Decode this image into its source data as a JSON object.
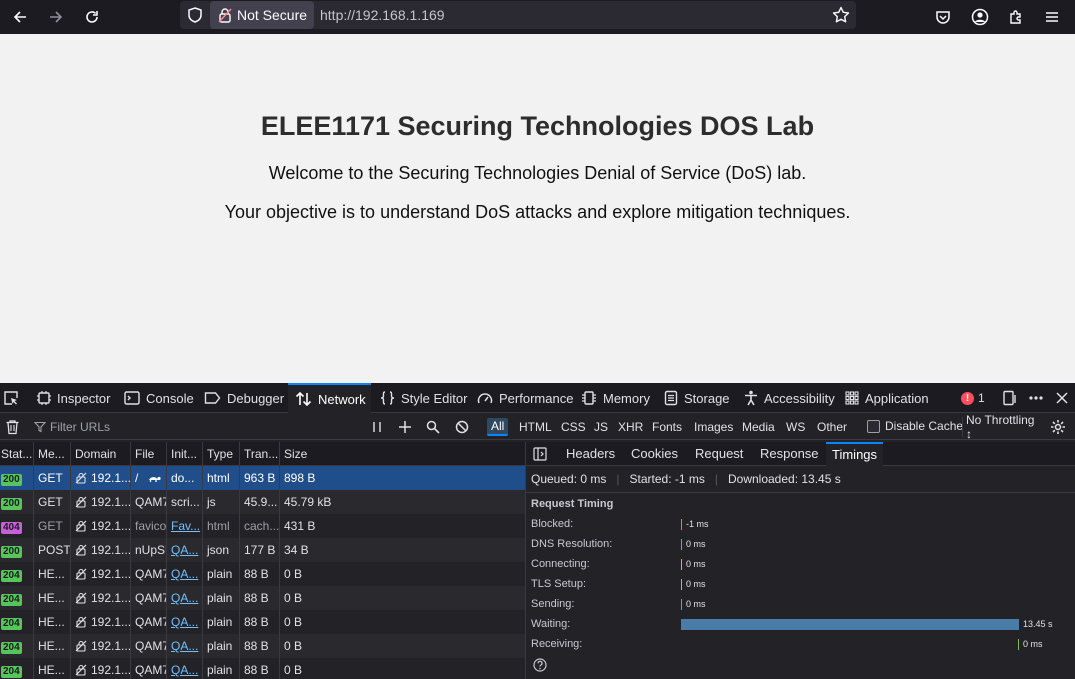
{
  "browser": {
    "security_label": "Not Secure",
    "url": "http://192.168.1.169"
  },
  "page": {
    "heading": "ELEE1171 Securing Technologies DOS Lab",
    "welcome": "Welcome to the Securing Technologies Denial of Service (DoS) lab.",
    "objective": "Your objective is to understand DoS attacks and explore mitigation techniques."
  },
  "devtools": {
    "tabs": [
      "Inspector",
      "Console",
      "Debugger",
      "Network",
      "Style Editor",
      "Performance",
      "Memory",
      "Storage",
      "Accessibility",
      "Application"
    ],
    "error_count": "1",
    "filter_placeholder": "Filter URLs",
    "filter_types": [
      "All",
      "HTML",
      "CSS",
      "JS",
      "XHR",
      "Fonts",
      "Images",
      "Media",
      "WS",
      "Other"
    ],
    "disable_cache_label": "Disable Cache",
    "throttling": "No Throttling ↕",
    "columns": [
      "Stat...",
      "Me...",
      "Domain",
      "File",
      "Init...",
      "Type",
      "Tran...",
      "Size"
    ],
    "requests": [
      {
        "status": "200",
        "method": "GET",
        "domain": "192.1...",
        "file": "/",
        "initiator": "do...",
        "type": "html",
        "transferred": "963 B",
        "size": "898 B"
      },
      {
        "status": "200",
        "method": "GET",
        "domain": "192.1...",
        "file": "QAM7",
        "initiator": "scri...",
        "type": "js",
        "transferred": "45.9...",
        "size": "45.79 kB"
      },
      {
        "status": "404",
        "method": "GET",
        "domain": "192.1...",
        "file": "favicon",
        "initiator": "Fav...",
        "type": "html",
        "transferred": "cach...",
        "size": "431 B"
      },
      {
        "status": "200",
        "method": "POST",
        "domain": "192.1...",
        "file": "nUpSU",
        "initiator": "QA...",
        "type": "json",
        "transferred": "177 B",
        "size": "34 B"
      },
      {
        "status": "204",
        "method": "HE...",
        "domain": "192.1...",
        "file": "QAM7",
        "initiator": "QA...",
        "type": "plain",
        "transferred": "88 B",
        "size": "0 B"
      },
      {
        "status": "204",
        "method": "HE...",
        "domain": "192.1...",
        "file": "QAM7",
        "initiator": "QA...",
        "type": "plain",
        "transferred": "88 B",
        "size": "0 B"
      },
      {
        "status": "204",
        "method": "HE...",
        "domain": "192.1...",
        "file": "QAM7",
        "initiator": "QA...",
        "type": "plain",
        "transferred": "88 B",
        "size": "0 B"
      },
      {
        "status": "204",
        "method": "HE...",
        "domain": "192.1...",
        "file": "QAM7",
        "initiator": "QA...",
        "type": "plain",
        "transferred": "88 B",
        "size": "0 B"
      },
      {
        "status": "204",
        "method": "HE...",
        "domain": "192.1...",
        "file": "QAM7",
        "initiator": "QA...",
        "type": "plain",
        "transferred": "88 B",
        "size": "0 B"
      }
    ],
    "side_tabs": [
      "Headers",
      "Cookies",
      "Request",
      "Response",
      "Timings"
    ],
    "summary": {
      "queued": "Queued: 0 ms",
      "started": "Started: -1 ms",
      "downloaded": "Downloaded: 13.45 s"
    },
    "request_timing_title": "Request Timing",
    "timings": [
      {
        "label": "Blocked:",
        "value": "-1 ms",
        "color": "#e26bbd",
        "fraction": 0.0
      },
      {
        "label": "DNS Resolution:",
        "value": "0 ms",
        "color": "#c56fe0",
        "fraction": 0.0
      },
      {
        "label": "Connecting:",
        "value": "0 ms",
        "color": "#f0a050",
        "fraction": 0.0
      },
      {
        "label": "TLS Setup:",
        "value": "0 ms",
        "color": "#f0a050",
        "fraction": 0.0
      },
      {
        "label": "Sending:",
        "value": "0 ms",
        "color": "#5fa0d8",
        "fraction": 0.0
      },
      {
        "label": "Waiting:",
        "value": "13.45 s",
        "color": "#4a7ca8",
        "fraction": 1.0
      },
      {
        "label": "Receiving:",
        "value": "0 ms",
        "color": "#8ab45c",
        "fraction": 0.0
      }
    ]
  }
}
